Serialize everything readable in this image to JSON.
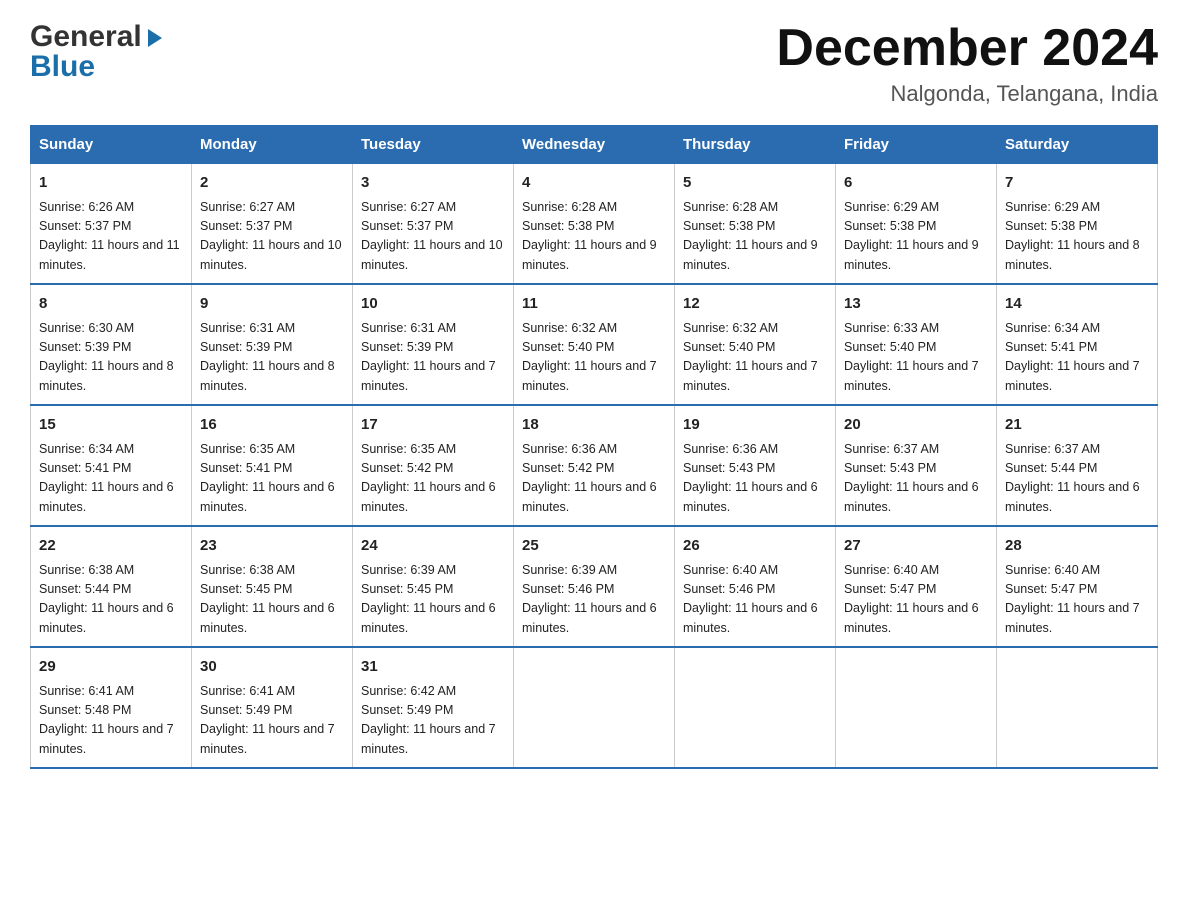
{
  "logo": {
    "general": "General",
    "blue": "Blue",
    "arrow_symbol": "▶"
  },
  "title": {
    "month_year": "December 2024",
    "location": "Nalgonda, Telangana, India"
  },
  "headers": [
    "Sunday",
    "Monday",
    "Tuesday",
    "Wednesday",
    "Thursday",
    "Friday",
    "Saturday"
  ],
  "weeks": [
    [
      {
        "day": "1",
        "sunrise": "6:26 AM",
        "sunset": "5:37 PM",
        "daylight": "11 hours and 11 minutes."
      },
      {
        "day": "2",
        "sunrise": "6:27 AM",
        "sunset": "5:37 PM",
        "daylight": "11 hours and 10 minutes."
      },
      {
        "day": "3",
        "sunrise": "6:27 AM",
        "sunset": "5:37 PM",
        "daylight": "11 hours and 10 minutes."
      },
      {
        "day": "4",
        "sunrise": "6:28 AM",
        "sunset": "5:38 PM",
        "daylight": "11 hours and 9 minutes."
      },
      {
        "day": "5",
        "sunrise": "6:28 AM",
        "sunset": "5:38 PM",
        "daylight": "11 hours and 9 minutes."
      },
      {
        "day": "6",
        "sunrise": "6:29 AM",
        "sunset": "5:38 PM",
        "daylight": "11 hours and 9 minutes."
      },
      {
        "day": "7",
        "sunrise": "6:29 AM",
        "sunset": "5:38 PM",
        "daylight": "11 hours and 8 minutes."
      }
    ],
    [
      {
        "day": "8",
        "sunrise": "6:30 AM",
        "sunset": "5:39 PM",
        "daylight": "11 hours and 8 minutes."
      },
      {
        "day": "9",
        "sunrise": "6:31 AM",
        "sunset": "5:39 PM",
        "daylight": "11 hours and 8 minutes."
      },
      {
        "day": "10",
        "sunrise": "6:31 AM",
        "sunset": "5:39 PM",
        "daylight": "11 hours and 7 minutes."
      },
      {
        "day": "11",
        "sunrise": "6:32 AM",
        "sunset": "5:40 PM",
        "daylight": "11 hours and 7 minutes."
      },
      {
        "day": "12",
        "sunrise": "6:32 AM",
        "sunset": "5:40 PM",
        "daylight": "11 hours and 7 minutes."
      },
      {
        "day": "13",
        "sunrise": "6:33 AM",
        "sunset": "5:40 PM",
        "daylight": "11 hours and 7 minutes."
      },
      {
        "day": "14",
        "sunrise": "6:34 AM",
        "sunset": "5:41 PM",
        "daylight": "11 hours and 7 minutes."
      }
    ],
    [
      {
        "day": "15",
        "sunrise": "6:34 AM",
        "sunset": "5:41 PM",
        "daylight": "11 hours and 6 minutes."
      },
      {
        "day": "16",
        "sunrise": "6:35 AM",
        "sunset": "5:41 PM",
        "daylight": "11 hours and 6 minutes."
      },
      {
        "day": "17",
        "sunrise": "6:35 AM",
        "sunset": "5:42 PM",
        "daylight": "11 hours and 6 minutes."
      },
      {
        "day": "18",
        "sunrise": "6:36 AM",
        "sunset": "5:42 PM",
        "daylight": "11 hours and 6 minutes."
      },
      {
        "day": "19",
        "sunrise": "6:36 AM",
        "sunset": "5:43 PM",
        "daylight": "11 hours and 6 minutes."
      },
      {
        "day": "20",
        "sunrise": "6:37 AM",
        "sunset": "5:43 PM",
        "daylight": "11 hours and 6 minutes."
      },
      {
        "day": "21",
        "sunrise": "6:37 AM",
        "sunset": "5:44 PM",
        "daylight": "11 hours and 6 minutes."
      }
    ],
    [
      {
        "day": "22",
        "sunrise": "6:38 AM",
        "sunset": "5:44 PM",
        "daylight": "11 hours and 6 minutes."
      },
      {
        "day": "23",
        "sunrise": "6:38 AM",
        "sunset": "5:45 PM",
        "daylight": "11 hours and 6 minutes."
      },
      {
        "day": "24",
        "sunrise": "6:39 AM",
        "sunset": "5:45 PM",
        "daylight": "11 hours and 6 minutes."
      },
      {
        "day": "25",
        "sunrise": "6:39 AM",
        "sunset": "5:46 PM",
        "daylight": "11 hours and 6 minutes."
      },
      {
        "day": "26",
        "sunrise": "6:40 AM",
        "sunset": "5:46 PM",
        "daylight": "11 hours and 6 minutes."
      },
      {
        "day": "27",
        "sunrise": "6:40 AM",
        "sunset": "5:47 PM",
        "daylight": "11 hours and 6 minutes."
      },
      {
        "day": "28",
        "sunrise": "6:40 AM",
        "sunset": "5:47 PM",
        "daylight": "11 hours and 7 minutes."
      }
    ],
    [
      {
        "day": "29",
        "sunrise": "6:41 AM",
        "sunset": "5:48 PM",
        "daylight": "11 hours and 7 minutes."
      },
      {
        "day": "30",
        "sunrise": "6:41 AM",
        "sunset": "5:49 PM",
        "daylight": "11 hours and 7 minutes."
      },
      {
        "day": "31",
        "sunrise": "6:42 AM",
        "sunset": "5:49 PM",
        "daylight": "11 hours and 7 minutes."
      },
      null,
      null,
      null,
      null
    ]
  ],
  "cell_labels": {
    "sunrise": "Sunrise: ",
    "sunset": "Sunset: ",
    "daylight": "Daylight: "
  }
}
